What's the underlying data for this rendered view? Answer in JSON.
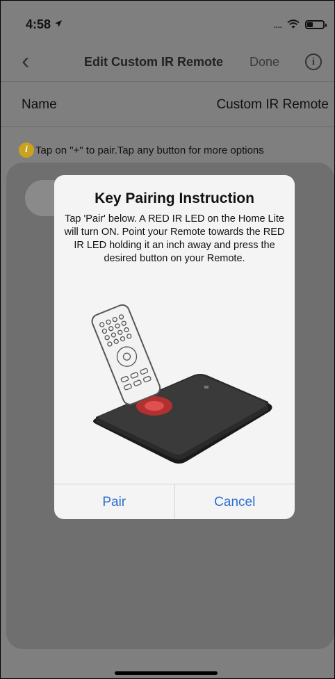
{
  "status_bar": {
    "time": "4:58",
    "location_icon": "location-arrow-icon",
    "signal": "....",
    "wifi_icon": "wifi-icon",
    "battery_icon": "battery-icon"
  },
  "nav": {
    "back_icon": "chevron-left-icon",
    "title": "Edit Custom IR Remote",
    "done_label": "Done",
    "info_icon": "info-icon",
    "info_glyph": "i"
  },
  "name_row": {
    "label": "Name",
    "value": "Custom IR Remote"
  },
  "hint": {
    "icon": "info-badge-icon",
    "icon_glyph": "i",
    "text": "Tap on \"+\" to pair.Tap any button for more options"
  },
  "dialog": {
    "title": "Key Pairing Instruction",
    "body": "Tap 'Pair' below. A RED IR LED on the Home Lite will turn ON. Point your Remote towards the RED IR LED holding it an inch away and press the desired button on your Remote.",
    "illustration": "remote-and-hub-illustration",
    "pair_label": "Pair",
    "cancel_label": "Cancel",
    "button_color": "#2b6fd1"
  },
  "colors": {
    "overlay_background": "#7f7f7f",
    "dialog_background": "#f4f4f4",
    "led_red": "#d43a3a"
  }
}
